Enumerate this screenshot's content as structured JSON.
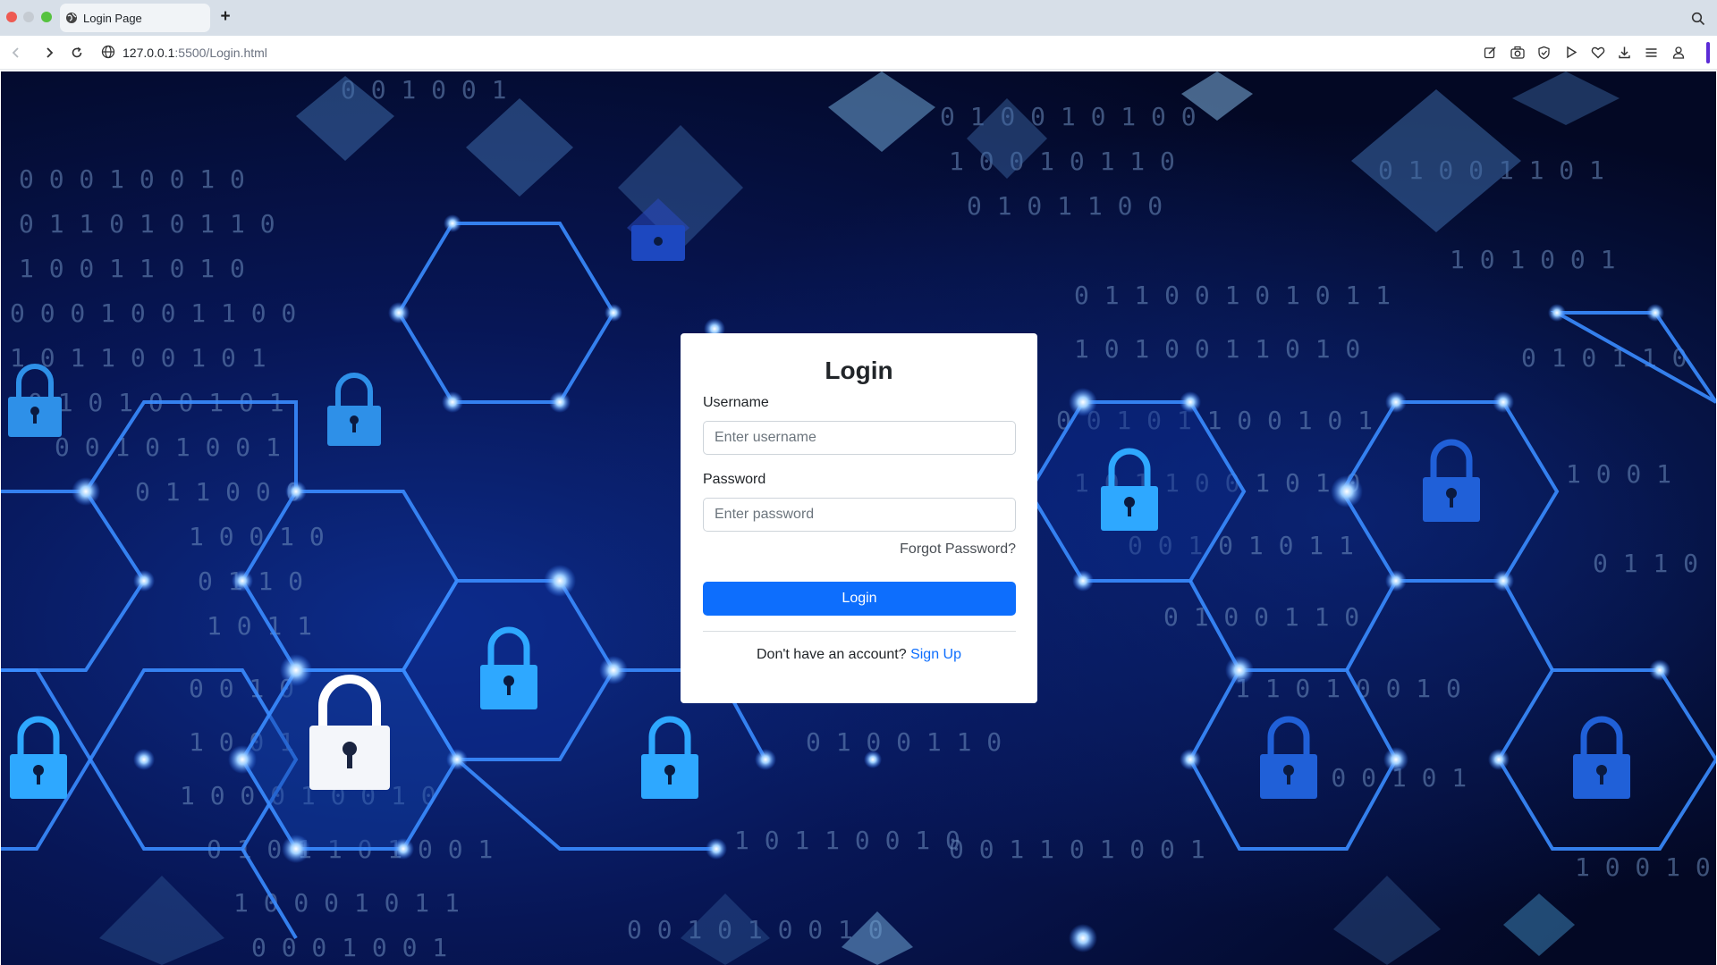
{
  "browser": {
    "tab_title": "Login Page",
    "new_tab_symbol": "+",
    "url_host": "127.0.0.1",
    "url_rest": ":5500/Login.html",
    "icons": [
      "globe-icon",
      "search-icon",
      "back-icon",
      "forward-icon",
      "reload-icon",
      "site-info-icon",
      "edit-icon",
      "camera-icon",
      "shield-icon",
      "play-icon",
      "heart-icon",
      "download-icon",
      "menu-icon",
      "profile-icon"
    ]
  },
  "login": {
    "title": "Login",
    "username_label": "Username",
    "username_placeholder": "Enter username",
    "username_value": "",
    "password_label": "Password",
    "password_placeholder": "Enter password",
    "password_value": "",
    "forgot_text": "Forgot Password?",
    "submit_label": "Login",
    "signup_prompt": "Don't have an account?",
    "signup_link": "Sign Up"
  },
  "colors": {
    "primary": "#0d6efd",
    "background_dark": "#040a24",
    "neon_blue": "#2f7bff"
  }
}
